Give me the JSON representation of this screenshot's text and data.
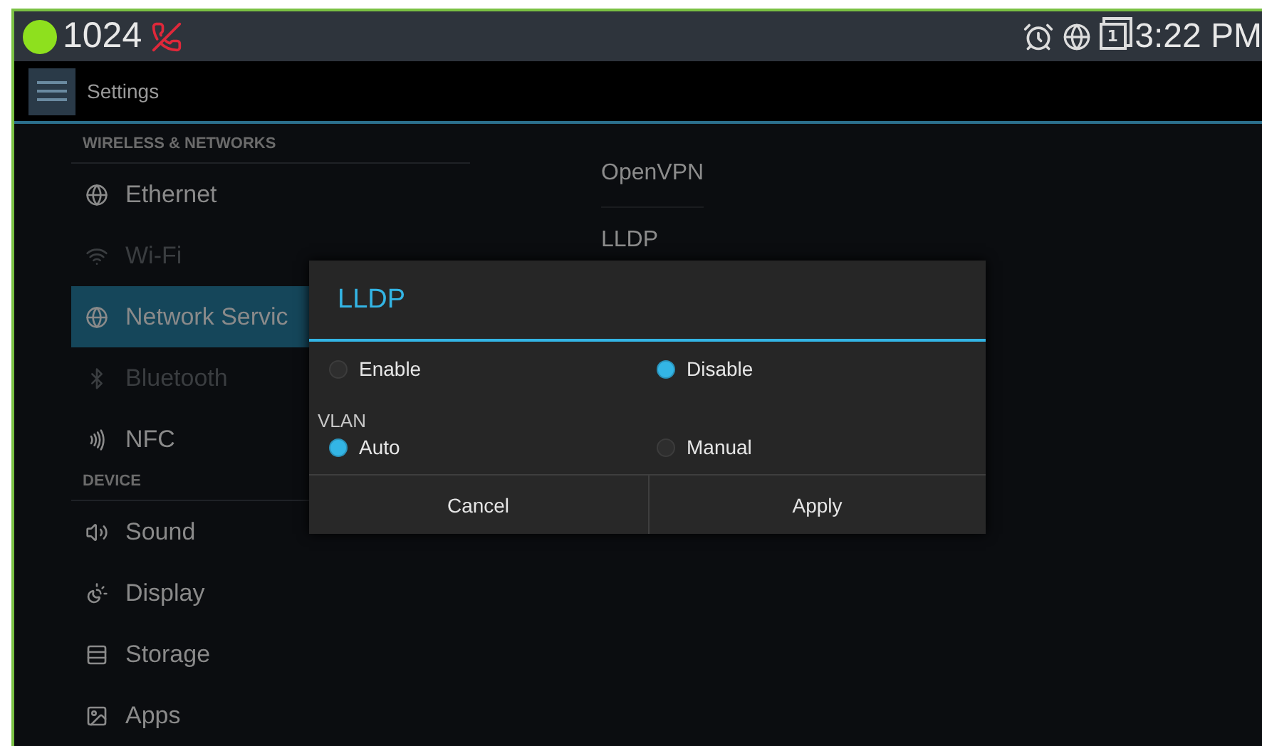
{
  "status_bar": {
    "extension": "1024",
    "sim_badge": "1",
    "clock": "3:22 PM"
  },
  "action_bar": {
    "title": "Settings"
  },
  "sidebar": {
    "sections": [
      {
        "header": "WIRELESS & NETWORKS",
        "items": [
          {
            "label": "Ethernet",
            "selected": false,
            "disabled": false
          },
          {
            "label": "Wi-Fi",
            "selected": false,
            "disabled": true
          },
          {
            "label": "Network Servic",
            "selected": true,
            "disabled": false
          },
          {
            "label": "Bluetooth",
            "selected": false,
            "disabled": true
          },
          {
            "label": "NFC",
            "selected": false,
            "disabled": false
          }
        ]
      },
      {
        "header": "DEVICE",
        "items": [
          {
            "label": "Sound",
            "selected": false,
            "disabled": false
          },
          {
            "label": "Display",
            "selected": false,
            "disabled": false
          },
          {
            "label": "Storage",
            "selected": false,
            "disabled": false
          },
          {
            "label": "Apps",
            "selected": false,
            "disabled": false
          }
        ]
      }
    ]
  },
  "detail": {
    "items": [
      "OpenVPN",
      "LLDP"
    ]
  },
  "dialog": {
    "title": "LLDP",
    "groups": [
      {
        "options": [
          {
            "label": "Enable",
            "selected": false
          },
          {
            "label": "Disable",
            "selected": true
          }
        ]
      },
      {
        "label": "VLAN",
        "options": [
          {
            "label": "Auto",
            "selected": true
          },
          {
            "label": "Manual",
            "selected": false
          }
        ]
      }
    ],
    "buttons": [
      "Cancel",
      "Apply"
    ]
  }
}
